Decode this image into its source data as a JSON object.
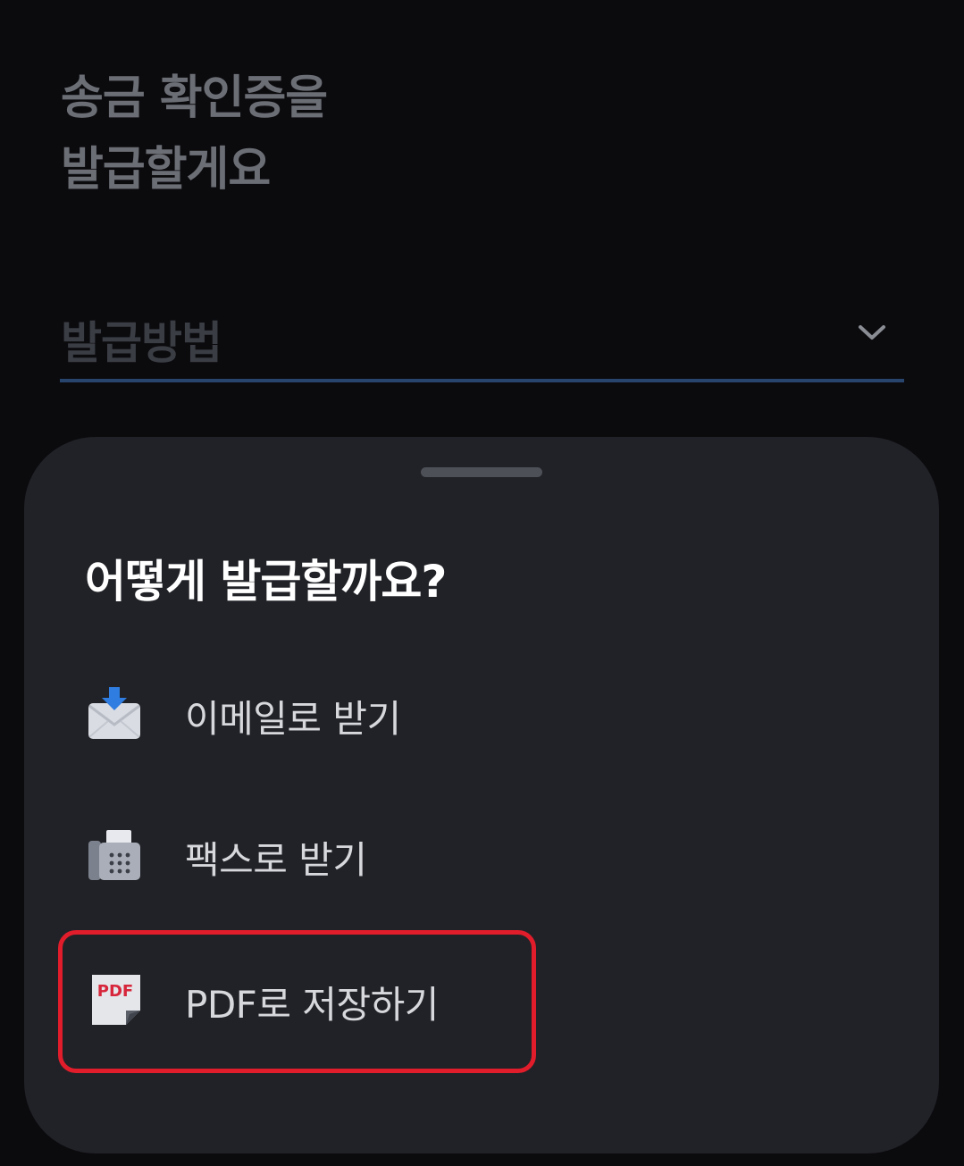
{
  "page": {
    "title_line1": "송금 확인증을",
    "title_line2": "발급할게요"
  },
  "method_select": {
    "placeholder": "발급방법",
    "icon": "chevron-down-icon"
  },
  "sheet": {
    "title": "어떻게 발급할까요?",
    "options": [
      {
        "label": "이메일로 받기",
        "icon": "email-download-icon"
      },
      {
        "label": "팩스로 받기",
        "icon": "fax-icon"
      },
      {
        "label": "PDF로 저장하기",
        "icon": "pdf-file-icon",
        "highlighted": true
      }
    ]
  },
  "colors": {
    "background": "#0b0b0e",
    "sheet": "#212227",
    "accent_underline": "#27456d",
    "highlight_border": "#e11d2b"
  }
}
